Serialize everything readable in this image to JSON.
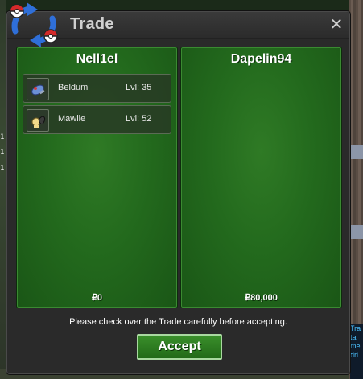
{
  "background": {
    "left_marks": [
      "1",
      "1",
      "1"
    ],
    "chat_snippet": [
      "Tra",
      "ta",
      "me",
      "dri"
    ]
  },
  "dialog": {
    "title": "Trade",
    "close_glyph": "✕"
  },
  "left_panel": {
    "trainer": "Nell1el",
    "items": [
      {
        "name": "Beldum",
        "level": "Lvl: 35",
        "icon": "beldum-icon"
      },
      {
        "name": "Mawile",
        "level": "Lvl: 52",
        "icon": "mawile-icon"
      }
    ],
    "money": "₽0"
  },
  "right_panel": {
    "trainer": "Dapelin94",
    "items": [],
    "money": "₽80,000"
  },
  "notice": "Please check over the Trade carefully before accepting.",
  "accept_label": "Accept",
  "colors": {
    "panel_green": "#236a1d",
    "button_green": "#2e7d22",
    "title_text": "#cfcfcf"
  }
}
